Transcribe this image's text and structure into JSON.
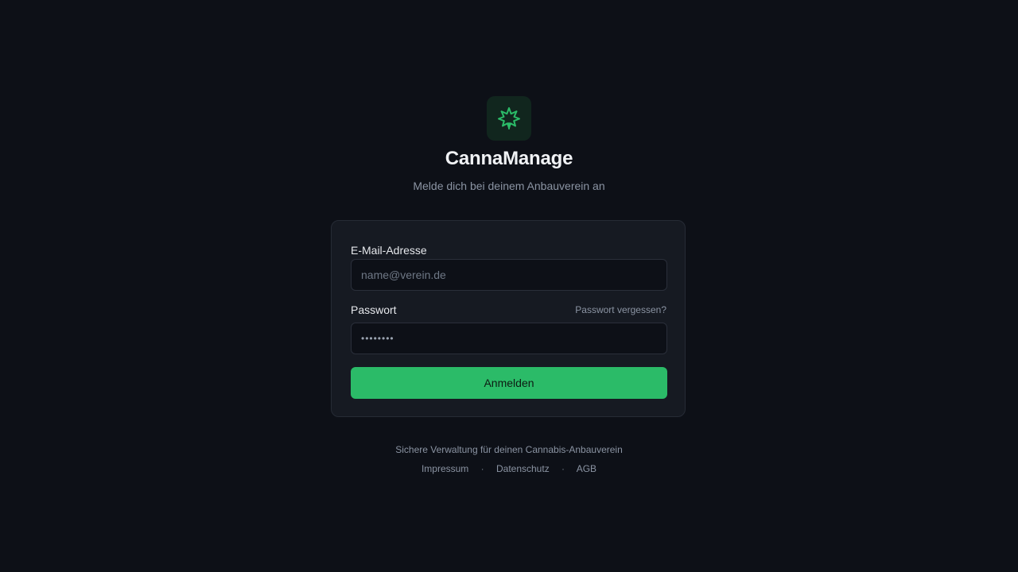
{
  "brand": {
    "name": "CannaManage",
    "subtitle": "Melde dich bei deinem Anbauverein an",
    "logo_icon": "cannabis-leaf-icon",
    "accent_color": "#2bbb68"
  },
  "login_form": {
    "email_label": "E-Mail-Adresse",
    "email_placeholder": "name@verein.de",
    "email_value": "",
    "password_label": "Passwort",
    "password_mask": "••••••••",
    "forgot_password": "Passwort vergessen?",
    "submit_label": "Anmelden"
  },
  "footer": {
    "tagline": "Sichere Verwaltung für deinen Cannabis-Anbauverein",
    "links": [
      "Impressum",
      "Datenschutz",
      "AGB"
    ],
    "separator": "·"
  }
}
